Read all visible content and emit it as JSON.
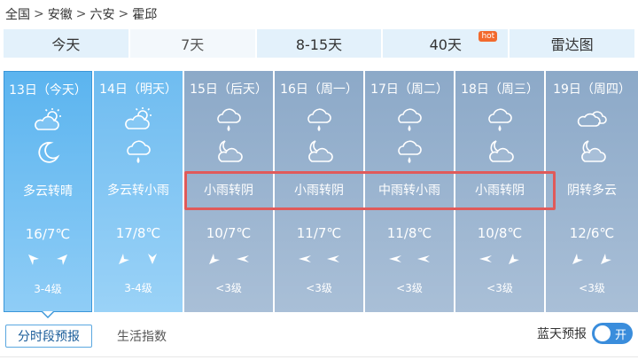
{
  "breadcrumb": [
    {
      "label": "全国"
    },
    {
      "label": "安徽"
    },
    {
      "label": "六安"
    },
    {
      "label": "霍邱"
    }
  ],
  "breadcrumb_separator": ">",
  "tabs": [
    {
      "label": "今天",
      "active": false
    },
    {
      "label": "7天",
      "active": true
    },
    {
      "label": "8-15天",
      "active": false
    },
    {
      "label": "40天",
      "active": false,
      "badge": "hot"
    },
    {
      "label": "雷达图",
      "active": false
    }
  ],
  "days": [
    {
      "date": "13日（今天）",
      "icon_day": "partly-cloudy-sun-icon",
      "icon_night": "moon-icon",
      "desc": "多云转晴",
      "temp": "16/7℃",
      "wind1": "wind-arrow-icon",
      "wind2": "wind-arrow-icon",
      "level": "3-4级"
    },
    {
      "date": "14日（明天）",
      "icon_day": "partly-cloudy-sun-icon",
      "icon_night": "rain-icon",
      "desc": "多云转小雨",
      "temp": "17/8℃",
      "wind1": "wind-arrow-icon",
      "wind2": "wind-arrow-icon",
      "level": "3-4级"
    },
    {
      "date": "15日（后天）",
      "icon_day": "rain-icon",
      "icon_night": "cloudy-moon-icon",
      "desc": "小雨转阴",
      "temp": "10/7℃",
      "wind1": "wind-arrow-icon",
      "wind2": "wind-arrow-icon",
      "level": "<3级"
    },
    {
      "date": "16日（周一）",
      "icon_day": "rain-icon",
      "icon_night": "cloudy-moon-icon",
      "desc": "小雨转阴",
      "temp": "11/7℃",
      "wind1": "wind-arrow-icon",
      "wind2": "wind-arrow-icon",
      "level": "<3级"
    },
    {
      "date": "17日（周二）",
      "icon_day": "rain-icon",
      "icon_night": "rain-icon",
      "desc": "中雨转小雨",
      "temp": "11/8℃",
      "wind1": "wind-arrow-icon",
      "wind2": "wind-arrow-icon",
      "level": "<3级"
    },
    {
      "date": "18日（周三）",
      "icon_day": "rain-icon",
      "icon_night": "cloudy-moon-icon",
      "desc": "小雨转阴",
      "temp": "10/8℃",
      "wind1": "wind-arrow-icon",
      "wind2": "wind-arrow-icon",
      "level": "<3级"
    },
    {
      "date": "19日（周四）",
      "icon_day": "cloudy-icon",
      "icon_night": "cloudy-moon-icon",
      "desc": "阴转多云",
      "temp": "12/6℃",
      "wind1": "wind-arrow-icon",
      "wind2": "wind-arrow-icon",
      "level": "<3级"
    }
  ],
  "sub_tabs": [
    {
      "label": "分时段预报",
      "active": true
    },
    {
      "label": "生活指数",
      "active": false
    }
  ],
  "bluesky": {
    "label": "蓝天预报",
    "toggle_label": "开",
    "on": true
  },
  "colors": {
    "accent": "#3a8ddc",
    "highlight": "#e05a5a",
    "hot": "#f26a2e"
  }
}
